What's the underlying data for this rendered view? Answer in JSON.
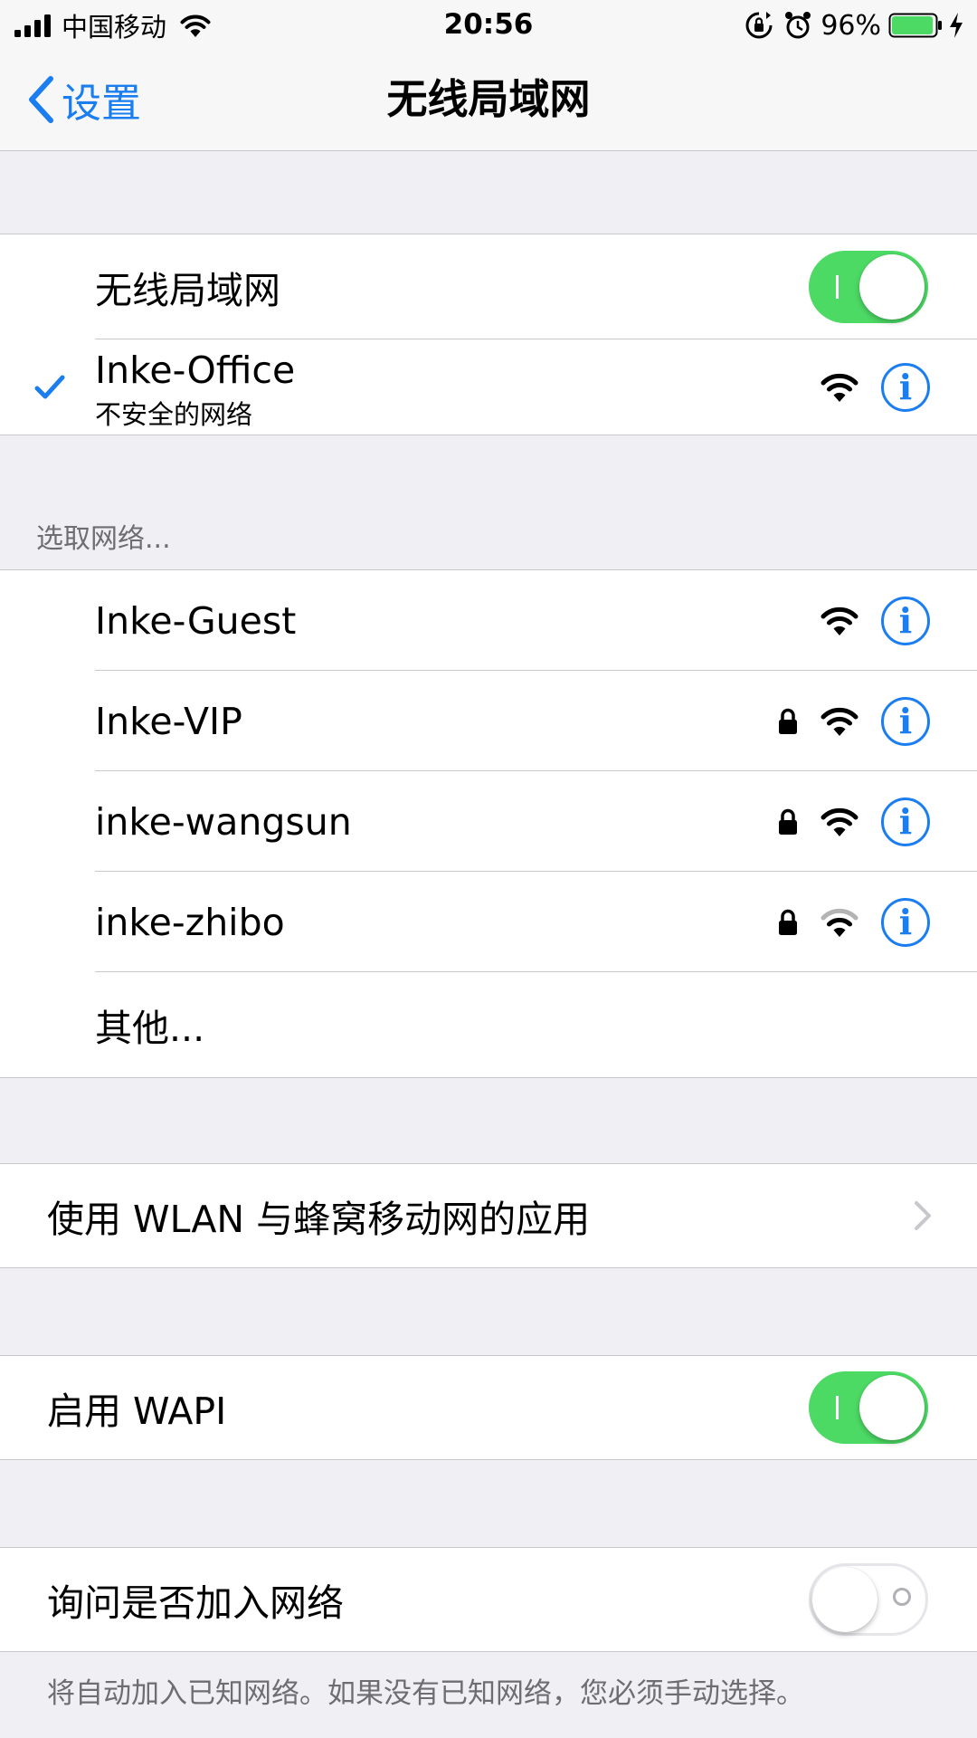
{
  "status_bar": {
    "carrier": "中国移动",
    "time": "20:56",
    "battery_percent": "96%",
    "battery_level": 0.96,
    "battery_color": "#4cd964"
  },
  "nav": {
    "back_label": "设置",
    "title": "无线局域网"
  },
  "wifi_section": {
    "label": "无线局域网",
    "enabled": true,
    "connected": {
      "name": "Inke-Office",
      "subtitle": "不安全的网络",
      "signal_bars": 3,
      "secured": false
    }
  },
  "networks_header": "选取网络...",
  "networks": [
    {
      "name": "Inke-Guest",
      "secured": false,
      "signal_bars": 3
    },
    {
      "name": "Inke-VIP",
      "secured": true,
      "signal_bars": 3
    },
    {
      "name": "inke-wangsun",
      "secured": true,
      "signal_bars": 3
    },
    {
      "name": "inke-zhibo",
      "secured": true,
      "signal_bars": 2
    }
  ],
  "other_label": "其他...",
  "apps_row_label": "使用 WLAN 与蜂窝移动网的应用",
  "wapi": {
    "label": "启用 WAPI",
    "enabled": true
  },
  "ask_join": {
    "label": "询问是否加入网络",
    "enabled": false
  },
  "footer_note": "将自动加入已知网络。如果没有已知网络，您必须手动选择。",
  "colors": {
    "accent": "#1a7df0",
    "toggle_on": "#4cd964",
    "background": "#efeff4"
  },
  "icons": {
    "signal": "cellular-signal-icon",
    "wifi": "wifi-icon",
    "lock": "lock-icon",
    "info": "info-icon",
    "alarm": "alarm-icon",
    "rotation_lock": "rotation-lock-icon",
    "charging": "charging-bolt-icon",
    "checkmark": "checkmark-icon",
    "chevron": "chevron-right-icon",
    "back": "chevron-left-icon"
  },
  "info_glyph": "i"
}
